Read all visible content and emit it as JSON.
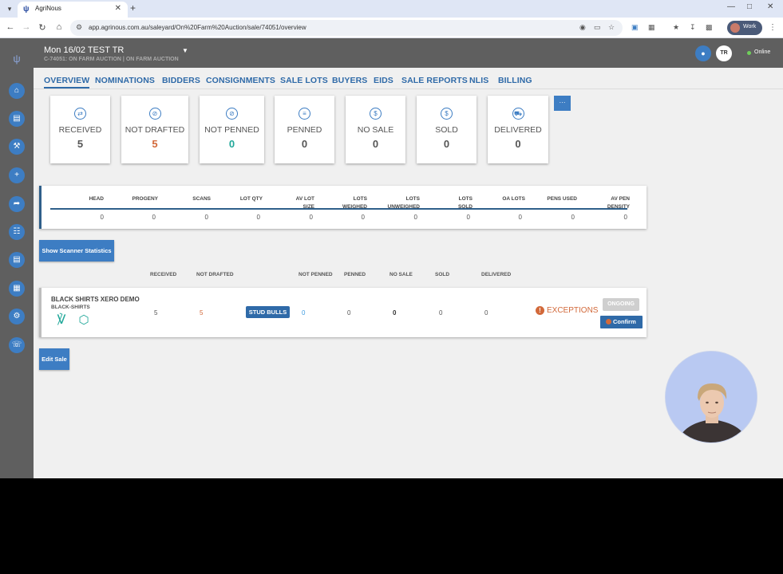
{
  "browser": {
    "tab_title": "AgriNous",
    "url": "app.agrinous.com.au/saleyard/On%20Farm%20Auction/sale/74051/overview",
    "profile_label": "Work"
  },
  "header": {
    "title": "Mon 16/02 TEST TR",
    "subtitle": "C-74051: ON FARM AUCTION | ON FARM AUCTION",
    "avatar_initials": "TR",
    "status": "Online"
  },
  "nav_tabs": [
    "OVERVIEW",
    "NOMINATIONS",
    "BIDDERS",
    "CONSIGNMENTS",
    "SALE LOTS",
    "BUYERS",
    "EIDS",
    "SALE REPORTS",
    "NLIS",
    "BILLING"
  ],
  "stat_cards": [
    {
      "label": "RECEIVED",
      "value": "5",
      "icon": "received-icon"
    },
    {
      "label": "NOT DRAFTED",
      "value": "5",
      "icon": "not-drafted-icon"
    },
    {
      "label": "NOT PENNED",
      "value": "0",
      "icon": "not-penned-icon"
    },
    {
      "label": "PENNED",
      "value": "0",
      "icon": "penned-icon"
    },
    {
      "label": "NO SALE",
      "value": "0",
      "icon": "no-sale-icon"
    },
    {
      "label": "SOLD",
      "value": "0",
      "icon": "sold-icon"
    },
    {
      "label": "DELIVERED",
      "value": "0",
      "icon": "delivered-icon"
    }
  ],
  "more_label": "···",
  "summary": {
    "headers": [
      "HEAD",
      "PROGENY",
      "SCANS",
      "LOT QTY",
      "AV LOT SIZE",
      "LOTS WEIGHED",
      "LOTS UNWEIGHED",
      "LOTS SOLD",
      "OA LOTS",
      "PENS USED",
      "AV PEN DENSITY"
    ],
    "values": [
      "0",
      "0",
      "0",
      "0",
      "0",
      "0",
      "0",
      "0",
      "0",
      "0",
      "0"
    ]
  },
  "buttons": {
    "scanner_stats": "Show Scanner Statistics",
    "edit_sale": "Edit Sale"
  },
  "lot_headers": [
    "RECEIVED",
    "NOT DRAFTED",
    "NOT PENNED",
    "PENNED",
    "NO SALE",
    "SOLD",
    "DELIVERED"
  ],
  "lot": {
    "name": "BLACK SHIRTS XERO DEMO",
    "code": "BLACK-SHIRTS",
    "received": "5",
    "not_drafted": "5",
    "category": "STUD BULLS",
    "not_penned": "0",
    "penned": "0",
    "no_sale": "0",
    "sold": "0",
    "delivered": "0",
    "exceptions_label": "EXCEPTIONS",
    "status": "ONGOING",
    "confirm_label": "Confirm"
  },
  "colors": {
    "accent": "#3d7dc3",
    "nav_text": "#2f6aa8",
    "warning": "#d2693a",
    "teal": "#22a89a",
    "sidebar": "#5f5f5f"
  }
}
